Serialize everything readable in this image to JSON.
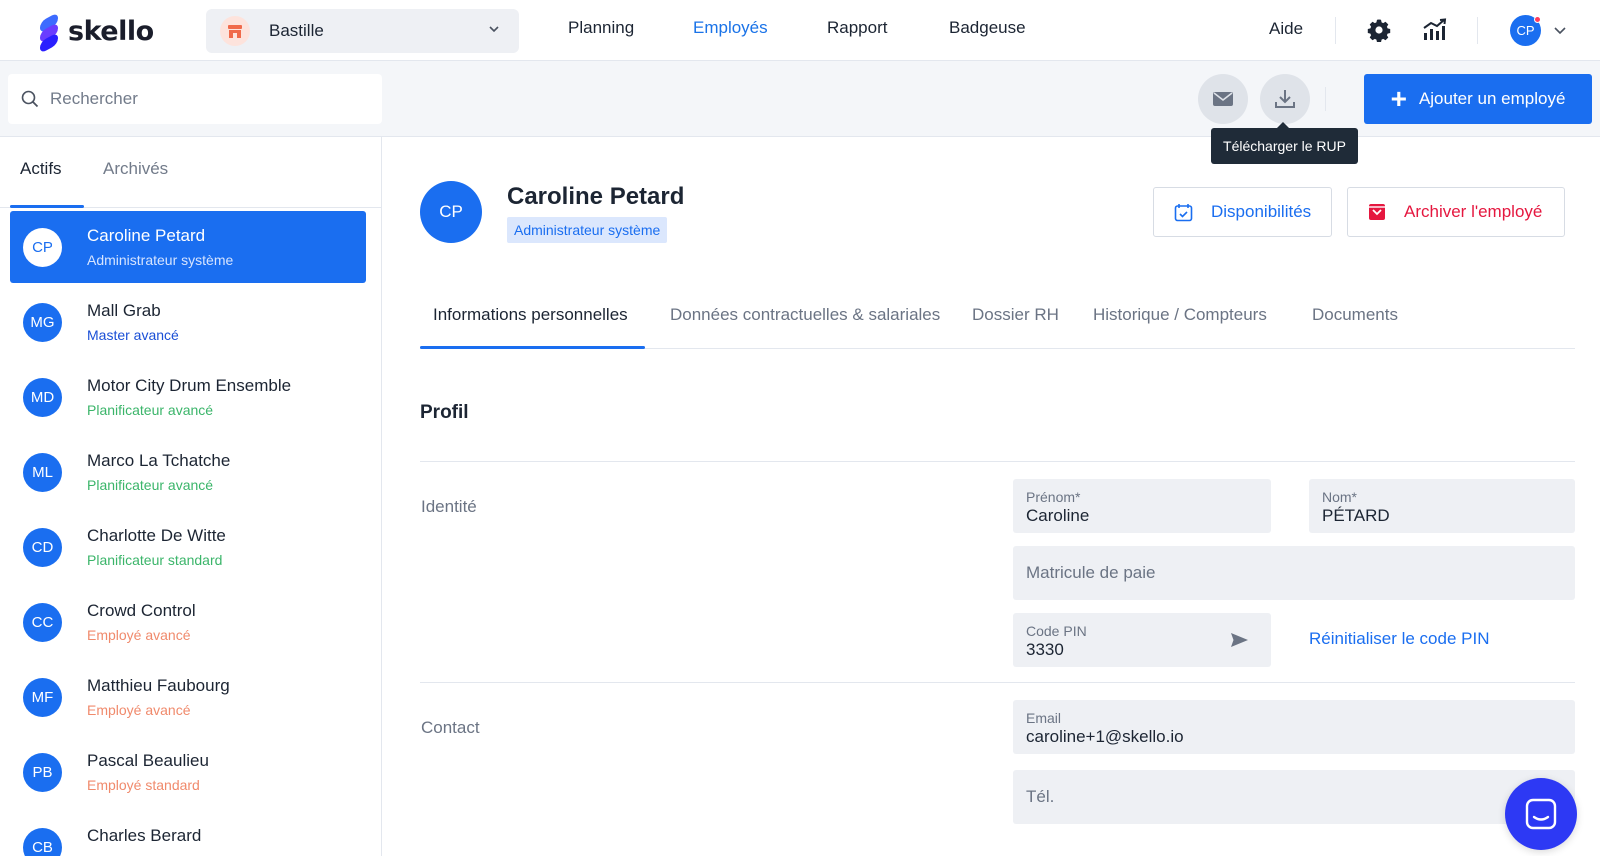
{
  "app": {
    "name": "skello"
  },
  "topbar": {
    "shop_label": "Bastille",
    "nav": [
      "Planning",
      "Employés",
      "Rapport",
      "Badgeuse"
    ],
    "active_nav": "Employés",
    "help_label": "Aide",
    "avatar_initials": "CP"
  },
  "subbar": {
    "search_placeholder": "Rechercher",
    "tooltip": "Télécharger le RUP",
    "add_button_label": "Ajouter un employé"
  },
  "sidebar": {
    "tabs": [
      "Actifs",
      "Archivés"
    ],
    "active_tab": "Actifs",
    "employees": [
      {
        "initials": "CP",
        "name": "Caroline Petard",
        "role": "Administrateur système",
        "role_color": "#d6e4ff",
        "selected": true
      },
      {
        "initials": "MG",
        "name": "Mall Grab",
        "role": "Master avancé",
        "role_color": "#1a4fd6"
      },
      {
        "initials": "MD",
        "name": "Motor City Drum Ensemble",
        "role": "Planificateur avancé",
        "role_color": "#3bb56a"
      },
      {
        "initials": "ML",
        "name": "Marco La Tchatche",
        "role": "Planificateur avancé",
        "role_color": "#3bb56a"
      },
      {
        "initials": "CD",
        "name": "Charlotte De Witte",
        "role": "Planificateur standard",
        "role_color": "#3bb56a"
      },
      {
        "initials": "CC",
        "name": "Crowd Control",
        "role": "Employé avancé",
        "role_color": "#f08a6c"
      },
      {
        "initials": "MF",
        "name": "Matthieu Faubourg",
        "role": "Employé avancé",
        "role_color": "#f08a6c"
      },
      {
        "initials": "PB",
        "name": "Pascal Beaulieu",
        "role": "Employé standard",
        "role_color": "#f08a6c"
      },
      {
        "initials": "CB",
        "name": "Charles Berard",
        "role": "",
        "role_color": "#f08a6c"
      }
    ]
  },
  "profile": {
    "initials": "CP",
    "name": "Caroline Petard",
    "role_badge": "Administrateur système",
    "availability_label": "Disponibilités",
    "archive_label": "Archiver l'employé"
  },
  "tabs": [
    "Informations personnelles",
    "Données contractuelles & salariales",
    "Dossier RH",
    "Historique / Compteurs",
    "Documents"
  ],
  "active_tab": "Informations personnelles",
  "form": {
    "section_title": "Profil",
    "identity_label": "Identité",
    "firstname_label": "Prénom*",
    "firstname_value": "Caroline",
    "lastname_label": "Nom*",
    "lastname_value": "PÉTARD",
    "payroll_placeholder": "Matricule de paie",
    "pin_label": "Code PIN",
    "pin_value": "3330",
    "reset_pin_label": "Réinitialiser le code PIN",
    "contact_label": "Contact",
    "email_label": "Email",
    "email_value": "caroline+1@skello.io",
    "phone_placeholder": "Tél."
  },
  "colors": {
    "accent": "#1a6ef0",
    "archive_red": "#e5173f",
    "chat": "#2d39f4"
  }
}
